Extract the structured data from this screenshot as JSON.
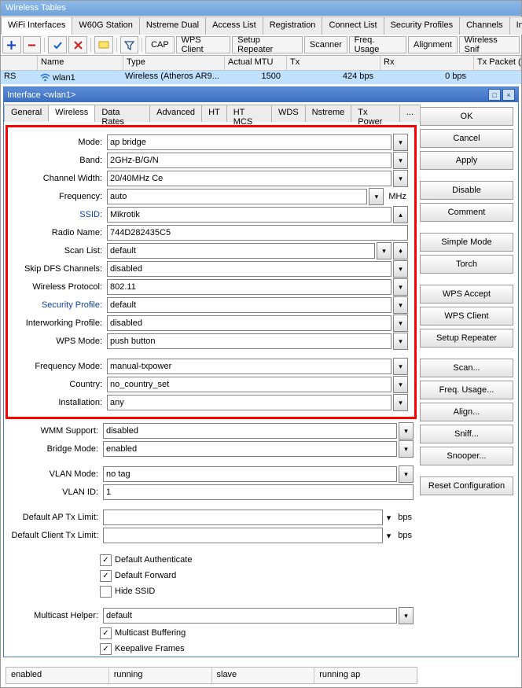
{
  "window_title": "Wireless Tables",
  "outer_tabs": [
    "WiFi Interfaces",
    "W60G Station",
    "Nstreme Dual",
    "Access List",
    "Registration",
    "Connect List",
    "Security Profiles",
    "Channels",
    "Interworkin"
  ],
  "outer_tab_active": 0,
  "toolbar": {
    "cap": "CAP",
    "wps_client": "WPS Client",
    "setup_repeater": "Setup Repeater",
    "scanner": "Scanner",
    "freq_usage": "Freq. Usage",
    "alignment": "Alignment",
    "wireless_sniffer": "Wireless Snif"
  },
  "list": {
    "headers": [
      "",
      "Name",
      "Type",
      "Actual MTU",
      "Tx",
      "Rx",
      "Tx Packet (p/s)"
    ],
    "row": {
      "flag": "RS",
      "name": "wlan1",
      "type": "Wireless (Atheros AR9...",
      "mtu": "1500",
      "tx": "424 bps",
      "rx": "0 bps"
    }
  },
  "sub_title": "Interface <wlan1>",
  "sub_tabs": [
    "General",
    "Wireless",
    "Data Rates",
    "Advanced",
    "HT",
    "HT MCS",
    "WDS",
    "Nstreme",
    "Tx Power",
    "..."
  ],
  "sub_tab_active": 1,
  "buttons": {
    "ok": "OK",
    "cancel": "Cancel",
    "apply": "Apply",
    "disable": "Disable",
    "comment": "Comment",
    "simple": "Simple Mode",
    "torch": "Torch",
    "wps_accept": "WPS Accept",
    "wps_client": "WPS Client",
    "setup_repeater": "Setup Repeater",
    "scan": "Scan...",
    "freq_usage": "Freq. Usage...",
    "align": "Align...",
    "sniff": "Sniff...",
    "snooper": "Snooper...",
    "reset": "Reset Configuration"
  },
  "fields": {
    "mode": {
      "label": "Mode:",
      "value": "ap bridge"
    },
    "band": {
      "label": "Band:",
      "value": "2GHz-B/G/N"
    },
    "channel_width": {
      "label": "Channel Width:",
      "value": "20/40MHz Ce"
    },
    "frequency": {
      "label": "Frequency:",
      "value": "auto",
      "unit": "MHz"
    },
    "ssid": {
      "label": "SSID:",
      "value": "Mikrotik"
    },
    "radio_name": {
      "label": "Radio Name:",
      "value": "744D282435C5"
    },
    "scan_list": {
      "label": "Scan List:",
      "value": "default"
    },
    "skip_dfs": {
      "label": "Skip DFS Channels:",
      "value": "disabled"
    },
    "wireless_protocol": {
      "label": "Wireless Protocol:",
      "value": "802.11"
    },
    "security_profile": {
      "label": "Security Profile:",
      "value": "default"
    },
    "interworking_profile": {
      "label": "Interworking Profile:",
      "value": "disabled"
    },
    "wps_mode": {
      "label": "WPS Mode:",
      "value": "push button"
    },
    "frequency_mode": {
      "label": "Frequency Mode:",
      "value": "manual-txpower"
    },
    "country": {
      "label": "Country:",
      "value": "no_country_set"
    },
    "installation": {
      "label": "Installation:",
      "value": "any"
    },
    "wmm_support": {
      "label": "WMM Support:",
      "value": "disabled"
    },
    "bridge_mode": {
      "label": "Bridge Mode:",
      "value": "enabled"
    },
    "vlan_mode": {
      "label": "VLAN Mode:",
      "value": "no tag"
    },
    "vlan_id": {
      "label": "VLAN ID:",
      "value": "1"
    },
    "def_ap_tx": {
      "label": "Default AP Tx Limit:",
      "value": "",
      "unit": "bps"
    },
    "def_client_tx": {
      "label": "Default Client Tx Limit:",
      "value": "",
      "unit": "bps"
    },
    "multicast_helper": {
      "label": "Multicast Helper:",
      "value": "default"
    }
  },
  "checks": {
    "default_authenticate": {
      "label": "Default Authenticate",
      "checked": true
    },
    "default_forward": {
      "label": "Default Forward",
      "checked": true
    },
    "hide_ssid": {
      "label": "Hide SSID",
      "checked": false
    },
    "multicast_buffering": {
      "label": "Multicast Buffering",
      "checked": true
    },
    "keepalive_frames": {
      "label": "Keepalive Frames",
      "checked": true
    }
  },
  "status": [
    "enabled",
    "running",
    "slave",
    "running ap"
  ]
}
